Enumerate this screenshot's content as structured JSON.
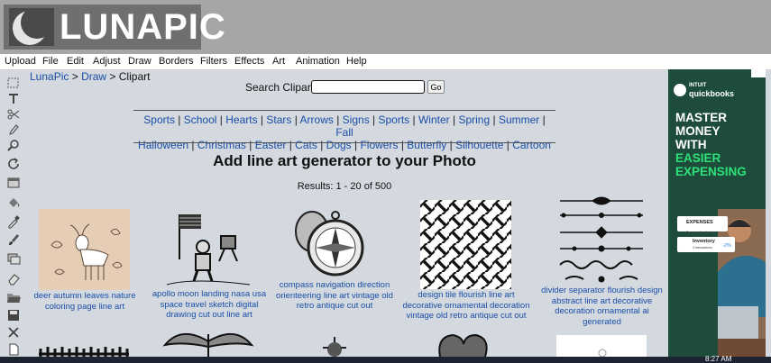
{
  "app": {
    "logo_text": "LUNAPIC"
  },
  "menu": [
    "Upload",
    "File",
    "Edit",
    "Adjust",
    "Draw",
    "Borders",
    "Filters",
    "Effects",
    "Art",
    "Animation",
    "Help"
  ],
  "breadcrumb": {
    "item1": "LunaPic",
    "sep1": " > ",
    "item2": "Draw",
    "sep2": " > ",
    "current": "Clipart"
  },
  "search": {
    "label": "Search Clipart:",
    "value": "",
    "button": "Go"
  },
  "categories": {
    "sep": " | ",
    "line1": [
      "Sports",
      "School",
      "Hearts",
      "Stars",
      "Arrows",
      "Signs",
      "Sports",
      "Winter",
      "Spring",
      "Summer",
      "Fall"
    ],
    "line2": [
      "Halloween",
      "Christmas",
      "Easter",
      "Cats",
      "Dogs",
      "Flowers",
      "Butterfly",
      "Silhouette",
      "Cartoon"
    ]
  },
  "heading": "Add line art generator to your Photo",
  "results": "Results: 1 - 20 of 500",
  "items": [
    {
      "caption": "deer autumn leaves nature coloring page line art"
    },
    {
      "caption": "apollo moon landing nasa usa space travel sketch digital drawing cut out line art"
    },
    {
      "caption": "compass navigation direction orienteering line art vintage old retro antique cut out"
    },
    {
      "caption": "design tile flourish line art decorative ornamental decoration vintage old retro antique cut out"
    },
    {
      "caption": "divider separator flourish design abstract line art decorative decoration ornamental ai generated"
    }
  ],
  "ad": {
    "brand_top": "INTUIT",
    "brand": "quickbooks",
    "headline": [
      "MASTER",
      "MONEY",
      "WITH",
      "EASIER",
      "EXPENSING"
    ],
    "headline_colors": [
      "#ffffff",
      "#ffffff",
      "#ffffff",
      "#2ee07a",
      "#2ee07a"
    ],
    "card1_title": "EXPENSES",
    "card1_sub": "Top spending last week",
    "card2_title": "Inventory",
    "card2_sub": "3 transactions",
    "card2_value": "-2%"
  },
  "taskbar": {
    "time": "8:27 AM"
  },
  "tools": [
    "marquee-select-icon",
    "text-icon",
    "scissors-icon",
    "pencil-icon",
    "zoom-icon",
    "rotate-icon",
    "layer-icon",
    "paint-bucket-icon",
    "eyedropper-icon",
    "brush-icon",
    "layers-icon",
    "eraser-icon",
    "open-folder-icon",
    "save-disk-icon",
    "close-x-icon",
    "new-page-icon"
  ]
}
